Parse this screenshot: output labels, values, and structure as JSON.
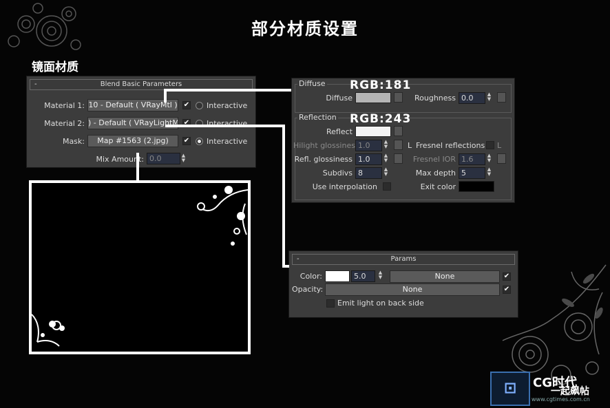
{
  "page": {
    "title": "部分材质设置",
    "subtitle": "镜面材质"
  },
  "blend": {
    "header": "Blend Basic Parameters",
    "minus": "-",
    "material1_label": "Material 1:",
    "material1_value": "10 - Default  ( VRayMtl )",
    "material2_label": "Material 2:",
    "material2_value": ") - Default  ( VRayLightMtl )",
    "mask_label": "Mask:",
    "mask_value": "Map #1563 (2.jpg)",
    "interactive": "Interactive",
    "mix_label": "Mix Amount:",
    "mix_value": "0.0"
  },
  "vray": {
    "diffuse_group": "Diffuse",
    "diffuse_label": "Diffuse",
    "roughness_label": "Roughness",
    "roughness_value": "0.0",
    "reflection_group": "Reflection",
    "reflect_label": "Reflect",
    "hilight_label": "Hilight glossiness",
    "hilight_value": "1.0",
    "l_label": "L",
    "fresnel_label": "Fresnel reflections",
    "refl_gloss_label": "Refl. glossiness",
    "refl_gloss_value": "1.0",
    "fresnel_ior_label": "Fresnel IOR",
    "fresnel_ior_value": "1.6",
    "subdivs_label": "Subdivs",
    "subdivs_value": "8",
    "max_depth_label": "Max depth",
    "max_depth_value": "5",
    "use_interp_label": "Use interpolation",
    "exit_color_label": "Exit color",
    "diffuse_annotation": "RGB:181",
    "reflect_annotation": "RGB:243",
    "diffuse_color": "#b5b5b5",
    "reflect_color": "#f3f3f3"
  },
  "params": {
    "header": "Params",
    "minus": "-",
    "color_label": "Color:",
    "color_value": "5.0",
    "color_map": "None",
    "opacity_label": "Opacity:",
    "opacity_map": "None",
    "emit_label": "Emit light on back side"
  },
  "logo": {
    "text": "CG时代",
    "slogan": "一起飙帖",
    "url": "www.cgtimes.com.cn"
  }
}
